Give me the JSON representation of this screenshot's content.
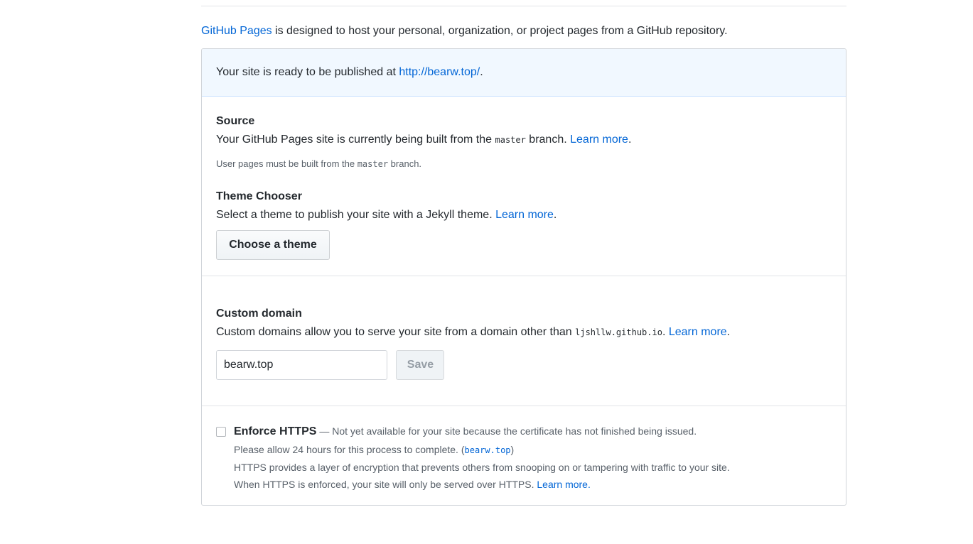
{
  "intro": {
    "link": "GitHub Pages",
    "text": " is designed to host your personal, organization, or project pages from a GitHub repository."
  },
  "flash": {
    "text": "Your site is ready to be published at ",
    "url": "http://bearw.top/",
    "end": "."
  },
  "source": {
    "heading": "Source",
    "text_before": "Your GitHub Pages site is currently being built from the ",
    "branch": "master",
    "text_after": " branch. ",
    "learn_more": "Learn more",
    "end": ".",
    "note_before": "User pages must be built from the ",
    "note_branch": "master",
    "note_after": " branch."
  },
  "theme": {
    "heading": "Theme Chooser",
    "text": "Select a theme to publish your site with a Jekyll theme. ",
    "learn_more": "Learn more",
    "end": ".",
    "button": "Choose a theme"
  },
  "domain": {
    "heading": "Custom domain",
    "text": "Custom domains allow you to serve your site from a domain other than ",
    "default_domain": "ljshllw.github.io",
    "mid": ". ",
    "learn_more": "Learn more",
    "end": ".",
    "input_value": "bearw.top",
    "save": "Save"
  },
  "https": {
    "title": "Enforce HTTPS",
    "status": " — Not yet available for your site because the certificate has not finished being issued.",
    "allow_before": "Please allow 24 hours for this process to complete. (",
    "allow_domain": "bearw.top",
    "allow_after": ")",
    "desc1": "HTTPS provides a layer of encryption that prevents others from snooping on or tampering with traffic to your site.",
    "desc2": "When HTTPS is enforced, your site will only be served over HTTPS. ",
    "learn_more": "Learn more."
  }
}
